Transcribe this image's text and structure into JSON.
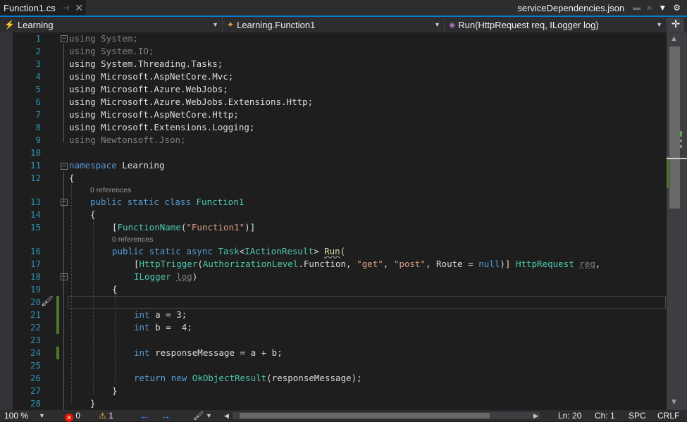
{
  "tabs": {
    "active": "Function1.cs",
    "right": "serviceDependencies.json"
  },
  "nav": {
    "project": "Learning",
    "class": "Learning.Function1",
    "member": "Run(HttpRequest req, ILogger log)"
  },
  "code": {
    "line_numbers": [
      "1",
      "2",
      "3",
      "4",
      "5",
      "6",
      "7",
      "8",
      "9",
      "10",
      "11",
      "12",
      "13",
      "14",
      "15",
      "16",
      "17",
      "18",
      "19",
      "20",
      "21",
      "22",
      "23",
      "24",
      "25",
      "26",
      "27",
      "28"
    ],
    "codelens": "0 references",
    "l1": "using System;",
    "l2": "using System.IO;",
    "l3": "using System.Threading.Tasks;",
    "l4": "using Microsoft.AspNetCore.Mvc;",
    "l5": "using Microsoft.Azure.WebJobs;",
    "l6": "using Microsoft.Azure.WebJobs.Extensions.Http;",
    "l7": "using Microsoft.AspNetCore.Http;",
    "l8": "using Microsoft.Extensions.Logging;",
    "l9": "using Newtonsoft.Json;",
    "l11a": "namespace",
    "l11b": " Learning",
    "l12": "{",
    "l13a": "public static class",
    "l13b": "Function1",
    "l14": "{",
    "l15a": "[",
    "l15b": "FunctionName",
    "l15c": "(",
    "l15d": "\"Function1\"",
    "l15e": ")]",
    "l16a": "public static async",
    "l16b": "Task",
    "l16c": "<",
    "l16d": "IActionResult",
    "l16e": "> ",
    "l16f": "Run",
    "l16g": "(",
    "l17a": "[",
    "l17b": "HttpTrigger",
    "l17c": "(",
    "l17d": "AuthorizationLevel",
    "l17e": ".Function, ",
    "l17f": "\"get\"",
    "l17g": ", ",
    "l17h": "\"post\"",
    "l17i": ", Route = ",
    "l17j": "null",
    "l17k": ")] ",
    "l17l": "HttpRequest",
    "l17m": "req",
    "l17n": ",",
    "l18a": "ILogger",
    "l18b": "log",
    "l18c": ")",
    "l19": "{",
    "l21a": "int",
    "l21b": " a = 3;",
    "l22a": "int",
    "l22b": " b =  4;",
    "l24a": "int",
    "l24b": " responseMessage = a + b;",
    "l26a": "return",
    "l26b": "new",
    "l26c": "OkObjectResult",
    "l26d": "(responseMessage);",
    "l27": "}",
    "l28": "}"
  },
  "status": {
    "zoom": "100 %",
    "errors": "0",
    "warnings": "1",
    "ln": "Ln: 20",
    "ch": "Ch: 1",
    "spc": "SPC",
    "eol": "CRLF"
  },
  "colors": {
    "background": "#1e1e1e",
    "keyword": "#569cd6",
    "type": "#4ec9b0",
    "string": "#d69d85",
    "method": "#dcdcaa",
    "line_number": "#2b91af",
    "accent": "#007acc",
    "change_marker": "#4b7a2b"
  }
}
